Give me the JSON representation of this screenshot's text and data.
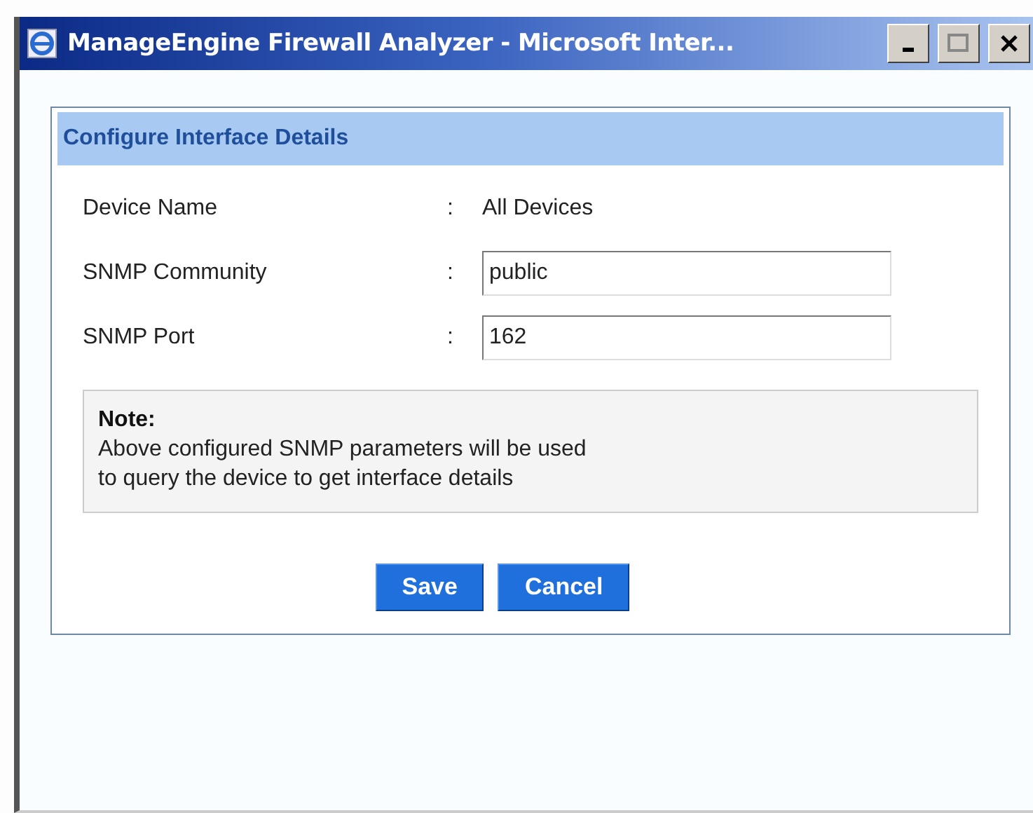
{
  "window": {
    "title": "ManageEngine Firewall Analyzer - Microsoft Inter..."
  },
  "panel": {
    "title": "Configure Interface Details"
  },
  "rows": [
    {
      "label": "Device Name",
      "separator": ":",
      "kind": "text",
      "value": "All Devices"
    },
    {
      "label": "SNMP Community",
      "separator": ":",
      "kind": "input",
      "value": "public"
    },
    {
      "label": "SNMP Port",
      "separator": ":",
      "kind": "input",
      "value": "162"
    }
  ],
  "note": {
    "title": "Note:",
    "lines": [
      "Above configured SNMP parameters will be used",
      "to query the device to get interface details"
    ]
  },
  "buttons": [
    "Save",
    "Cancel"
  ]
}
